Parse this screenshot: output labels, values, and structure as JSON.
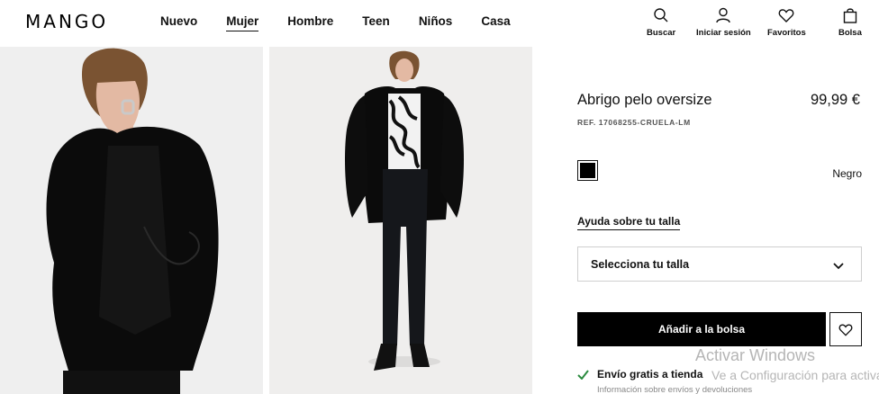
{
  "brand": {
    "logo": "MANGO"
  },
  "nav": {
    "items": [
      {
        "label": "Nuevo",
        "active": false
      },
      {
        "label": "Mujer",
        "active": true
      },
      {
        "label": "Hombre",
        "active": false
      },
      {
        "label": "Teen",
        "active": false
      },
      {
        "label": "Niños",
        "active": false
      },
      {
        "label": "Casa",
        "active": false
      }
    ]
  },
  "utilities": {
    "search": {
      "label": "Buscar",
      "icon": "search-icon"
    },
    "login": {
      "label": "Iniciar sesión",
      "icon": "user-icon"
    },
    "favorites": {
      "label": "Favoritos",
      "icon": "heart-icon"
    },
    "bag": {
      "label": "Bolsa",
      "icon": "bag-icon"
    }
  },
  "product": {
    "title": "Abrigo pelo oversize",
    "price": "99,99 €",
    "ref": "REF. 17068255-CRUELA-LM",
    "color": {
      "name": "Negro",
      "hex": "#000000"
    },
    "size_help": "Ayuda sobre tu talla",
    "size_select": "Selecciona tu talla",
    "add_button": "Añadir a la bolsa",
    "shipping": "Envío gratis a tienda",
    "shipping_info": "Información sobre envíos y devoluciones"
  },
  "watermark": {
    "line1": "Activar Windows",
    "line2": "Ve a Configuración para activar"
  },
  "colors": {
    "accent": "#000000",
    "check": "#2a8a3e"
  }
}
